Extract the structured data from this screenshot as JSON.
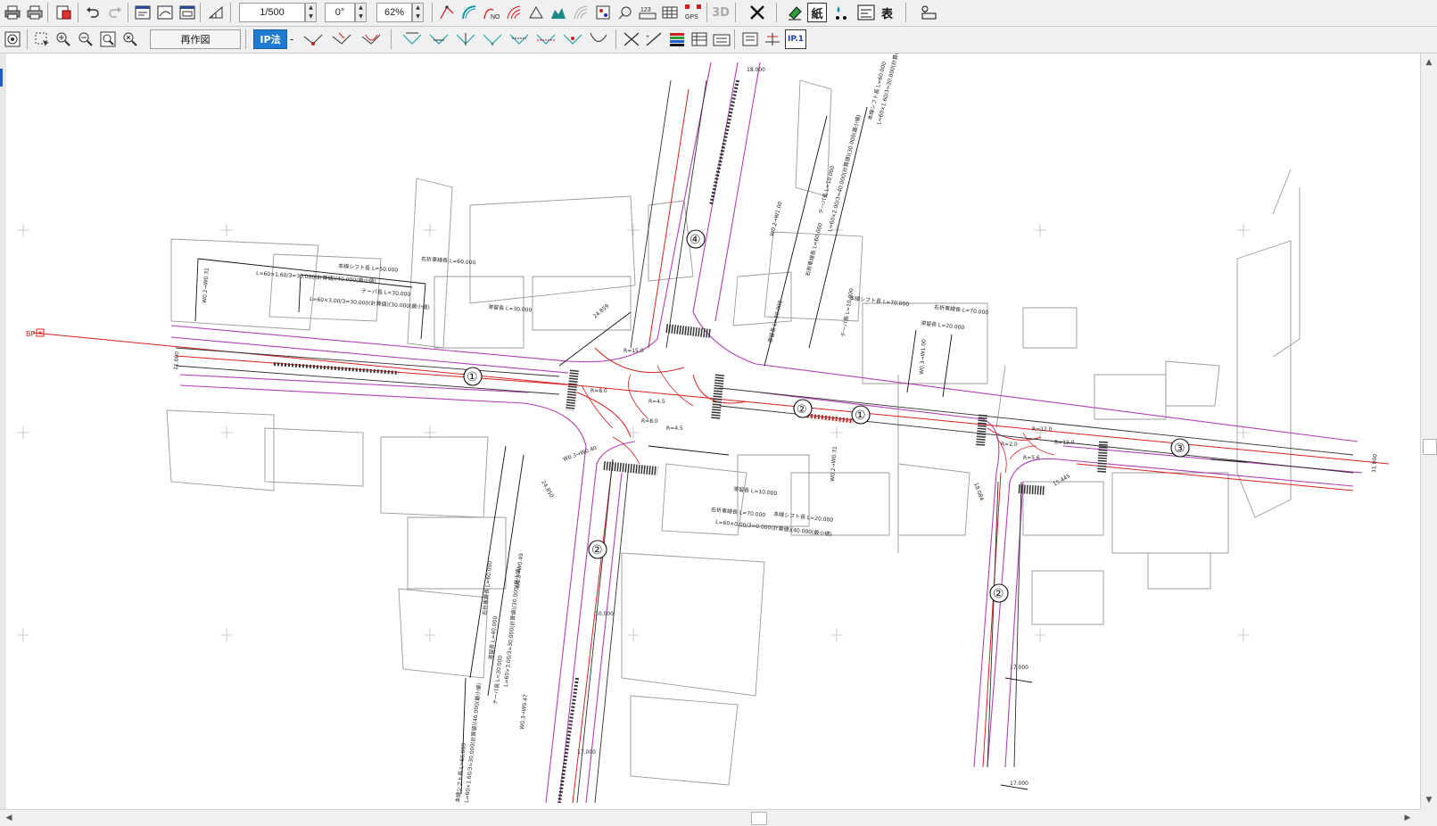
{
  "toolbar1": {
    "scale": "1/500",
    "angle": "0°",
    "zoom": "62%",
    "btn_3d": "3D",
    "btn_paper": "紙",
    "btn_table": "表",
    "btn_123": "123",
    "btn_gps": "GPS"
  },
  "toolbar2": {
    "redraw": "再作図",
    "ip_method": "IP法",
    "dash": "-",
    "ip1": "IP.1"
  },
  "drawing": {
    "road_labels": [
      "①",
      "②",
      "③",
      "④",
      "①",
      "②",
      "②",
      "①"
    ],
    "bp_marker": "BP",
    "annotations": [
      "右折車線長 L=60.000",
      "本線シフト長 L=50.000",
      "L=60×1.60/3=30.000(計算値)(40.000(最小値)",
      "テーパ長 L=30.000",
      "L=60×3.00/3=30.000(計算値)(30.000(最小値)",
      "滞留長 L=30.000",
      "本線シフト長 L=70.000",
      "右折車線長 L=70.000",
      "滞留長 L=20.000",
      "テーパ長 L=10.000",
      "右折車線長 L=70.000",
      "本線シフト長 L=20.000",
      "L=60×0.00/3=0.000(計算値)(40.000(最小値)",
      "滞留長 L=10.000",
      "滞留長 L=40.000",
      "右折車線長 L=60.000",
      "テーパ長 L=30.000",
      "L=60×3.00/3=30.000(計算値)(30.000(最小値)",
      "本線シフト長 L=60.000",
      "L=60×1.60/3=30.000(計算値)(40.000(最小値)",
      "本線シフト長 L=60.000",
      "L=60×1.60/3=30.000(計算値)(40.000(最小値)",
      "滞留長 L=30.000",
      "右折車線長 L=60.000",
      "テーパ長 L=10.000",
      "L=60×2.00/3=40.000(計算値)(30.000(最小値)",
      "24.859",
      "24.850",
      "11.000",
      "11.000",
      "18.000",
      "17.000",
      "17.000",
      "18.084",
      "15.445",
      "10.000",
      "17.000",
      "W0.3→W0.49",
      "W0.3→W0.40",
      "W0.2→W0.31",
      "W0.3→W0.47",
      "W0.3→W1.00",
      "W0.2→W0.31",
      "W0.2→W1.00",
      "R=12.0",
      "R=12.0",
      "R=15.0",
      "R=8.0",
      "R=8.0",
      "R=4.5",
      "R=4.5",
      "R=2.0",
      "R=5.6"
    ]
  }
}
